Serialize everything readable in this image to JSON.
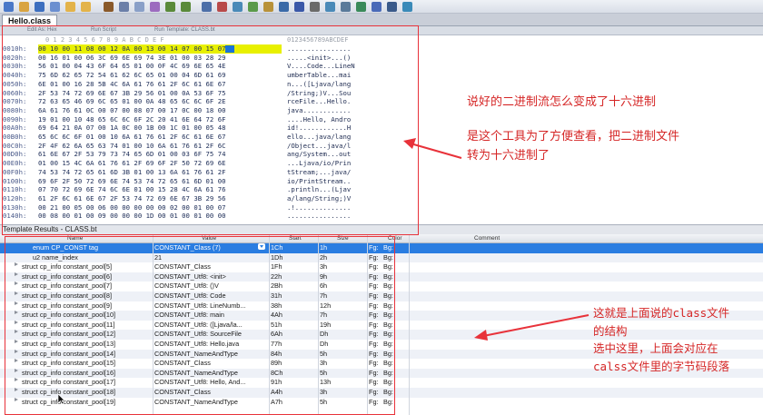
{
  "window": {
    "tab_title": "Hello.class"
  },
  "hex_header": {
    "col_edit_as": "Edit As: Hex",
    "col_run_script": "Run Script",
    "col_run_template": "Run Template: CLASS.bt"
  },
  "offset_ruler": "0 1 2 3 4 5 6 7 8 9 A B C D E F",
  "ascii_ruler": "0123456789ABCDEF",
  "hex_rows": [
    {
      "offset": "0010h:",
      "bytes": "00 10 00 11 08 00 12 0A 00 13 00 14 07 00 15 07",
      "ascii": "................",
      "highlight": true
    },
    {
      "offset": "0020h:",
      "bytes": "00 16 01 00 06 3C 69 6E 69 74 3E 01 00 03 28 29",
      "ascii": ".....<init>...()"
    },
    {
      "offset": "0030h:",
      "bytes": "56 01 00 04 43 6F 64 65 01 00 0F 4C 69 6E 65 4E",
      "ascii": "V....Code...LineN"
    },
    {
      "offset": "0040h:",
      "bytes": "75 6D 62 65 72 54 61 62 6C 65 01 00 04 6D 61 69",
      "ascii": "umberTable...mai"
    },
    {
      "offset": "0050h:",
      "bytes": "6E 01 00 16 28 5B 4C 6A 61 76 61 2F 6C 61 6E 67",
      "ascii": "n...([Ljava/lang"
    },
    {
      "offset": "0060h:",
      "bytes": "2F 53 74 72 69 6E 67 3B 29 56 01 00 0A 53 6F 75",
      "ascii": "/String;)V...Sou"
    },
    {
      "offset": "0070h:",
      "bytes": "72 63 65 46 69 6C 65 01 00 0A 48 65 6C 6C 6F 2E",
      "ascii": "rceFile...Hello."
    },
    {
      "offset": "0080h:",
      "bytes": "6A 61 76 61 0C 00 07 00 08 07 00 17 0C 00 18 00",
      "ascii": "java............"
    },
    {
      "offset": "0090h:",
      "bytes": "19 01 00 10 48 65 6C 6C 6F 2C 20 41 6E 64 72 6F",
      "ascii": "....Hello, Andro"
    },
    {
      "offset": "00A0h:",
      "bytes": "69 64 21 0A 07 00 1A 0C 00 1B 00 1C 01 00 05 48",
      "ascii": "id!............H"
    },
    {
      "offset": "00B0h:",
      "bytes": "65 6C 6C 6F 01 00 10 6A 61 76 61 2F 6C 61 6E 67",
      "ascii": "ello...java/lang"
    },
    {
      "offset": "00C0h:",
      "bytes": "2F 4F 62 6A 65 63 74 01 00 10 6A 61 76 61 2F 6C",
      "ascii": "/Object...java/l"
    },
    {
      "offset": "00D0h:",
      "bytes": "61 6E 67 2F 53 79 73 74 65 6D 01 00 03 6F 75 74",
      "ascii": "ang/System...out"
    },
    {
      "offset": "00E0h:",
      "bytes": "01 00 15 4C 6A 61 76 61 2F 69 6F 2F 50 72 69 6E",
      "ascii": "...Ljava/io/Prin"
    },
    {
      "offset": "00F0h:",
      "bytes": "74 53 74 72 65 61 6D 3B 01 00 13 6A 61 76 61 2F",
      "ascii": "tStream;...java/"
    },
    {
      "offset": "0100h:",
      "bytes": "69 6F 2F 50 72 69 6E 74 53 74 72 65 61 6D 01 00",
      "ascii": "io/PrintStream.."
    },
    {
      "offset": "0110h:",
      "bytes": "07 70 72 69 6E 74 6C 6E 01 00 15 28 4C 6A 61 76",
      "ascii": ".println...(Ljav"
    },
    {
      "offset": "0120h:",
      "bytes": "61 2F 6C 61 6E 67 2F 53 74 72 69 6E 67 3B 29 56",
      "ascii": "a/lang/String;)V"
    },
    {
      "offset": "0130h:",
      "bytes": "00 21 00 05 00 06 00 00 00 00 00 02 00 01 00 07",
      "ascii": ".!.............."
    },
    {
      "offset": "0140h:",
      "bytes": "00 08 00 01 00 09 00 00 00 1D 00 01 00 01 00 00",
      "ascii": "................"
    }
  ],
  "template": {
    "title": "Template Results - CLASS.bt",
    "headers": {
      "name": "Name",
      "value": "Value",
      "start": "Start",
      "size": "Size",
      "color": "Color",
      "comment": "Comment"
    },
    "rows": [
      {
        "name": "enum CP_CONST tag",
        "value": "CONSTANT_Class (7)",
        "start": "1Ch",
        "size": "1h",
        "fg": "Fg:",
        "bg": "Bg:",
        "selected": true,
        "indent": 1,
        "expand": false
      },
      {
        "name": "u2 name_index",
        "value": "21",
        "start": "1Dh",
        "size": "2h",
        "fg": "Fg:",
        "bg": "Bg:",
        "indent": 1,
        "expand": false
      },
      {
        "name": "struct cp_info constant_pool[5]",
        "value": "CONSTANT_Class",
        "start": "1Fh",
        "size": "3h",
        "fg": "Fg:",
        "bg": "Bg:",
        "indent": 0,
        "expand": true
      },
      {
        "name": "struct cp_info constant_pool[6]",
        "value": "CONSTANT_Utf8: <init>",
        "start": "22h",
        "size": "9h",
        "fg": "Fg:",
        "bg": "Bg:",
        "indent": 0,
        "expand": true
      },
      {
        "name": "struct cp_info constant_pool[7]",
        "value": "CONSTANT_Utf8: ()V",
        "start": "2Bh",
        "size": "6h",
        "fg": "Fg:",
        "bg": "Bg:",
        "indent": 0,
        "expand": true
      },
      {
        "name": "struct cp_info constant_pool[8]",
        "value": "CONSTANT_Utf8: Code",
        "start": "31h",
        "size": "7h",
        "fg": "Fg:",
        "bg": "Bg:",
        "indent": 0,
        "expand": true
      },
      {
        "name": "struct cp_info constant_pool[9]",
        "value": "CONSTANT_Utf8: LineNumb...",
        "start": "38h",
        "size": "12h",
        "fg": "Fg:",
        "bg": "Bg:",
        "indent": 0,
        "expand": true
      },
      {
        "name": "struct cp_info constant_pool[10]",
        "value": "CONSTANT_Utf8: main",
        "start": "4Ah",
        "size": "7h",
        "fg": "Fg:",
        "bg": "Bg:",
        "indent": 0,
        "expand": true
      },
      {
        "name": "struct cp_info constant_pool[11]",
        "value": "CONSTANT_Utf8: ([Ljava/la...",
        "start": "51h",
        "size": "19h",
        "fg": "Fg:",
        "bg": "Bg:",
        "indent": 0,
        "expand": true
      },
      {
        "name": "struct cp_info constant_pool[12]",
        "value": "CONSTANT_Utf8: SourceFile",
        "start": "6Ah",
        "size": "Dh",
        "fg": "Fg:",
        "bg": "Bg:",
        "indent": 0,
        "expand": true
      },
      {
        "name": "struct cp_info constant_pool[13]",
        "value": "CONSTANT_Utf8: Hello.java",
        "start": "77h",
        "size": "Dh",
        "fg": "Fg:",
        "bg": "Bg:",
        "indent": 0,
        "expand": true
      },
      {
        "name": "struct cp_info constant_pool[14]",
        "value": "CONSTANT_NameAndType",
        "start": "84h",
        "size": "5h",
        "fg": "Fg:",
        "bg": "Bg:",
        "indent": 0,
        "expand": true
      },
      {
        "name": "struct cp_info constant_pool[15]",
        "value": "CONSTANT_Class",
        "start": "89h",
        "size": "3h",
        "fg": "Fg:",
        "bg": "Bg:",
        "indent": 0,
        "expand": true
      },
      {
        "name": "struct cp_info constant_pool[16]",
        "value": "CONSTANT_NameAndType",
        "start": "8Ch",
        "size": "5h",
        "fg": "Fg:",
        "bg": "Bg:",
        "indent": 0,
        "expand": true
      },
      {
        "name": "struct cp_info constant_pool[17]",
        "value": "CONSTANT_Utf8: Hello, And...",
        "start": "91h",
        "size": "13h",
        "fg": "Fg:",
        "bg": "Bg:",
        "indent": 0,
        "expand": true
      },
      {
        "name": "struct cp_info constant_pool[18]",
        "value": "CONSTANT_Class",
        "start": "A4h",
        "size": "3h",
        "fg": "Fg:",
        "bg": "Bg:",
        "indent": 0,
        "expand": true
      },
      {
        "name": "struct cp_info constant_pool[19]",
        "value": "CONSTANT_NameAndType",
        "start": "A7h",
        "size": "5h",
        "fg": "Fg:",
        "bg": "Bg:",
        "indent": 0,
        "expand": true
      }
    ]
  },
  "annotations": {
    "note1": "说好的二进制流怎么变成了十六进制",
    "note2_line1": "是这个工具为了方便查看，把二进制文件",
    "note2_line2": "转为十六进制了",
    "note3_lines": [
      "这就是上面说的class文件",
      "的结构",
      "选中这里，上面会对应在",
      "calss文件里的字节码段落"
    ]
  },
  "colors": {
    "annotation_red": "#e8323a",
    "selection_blue": "#2a7de1",
    "highlight_yellow": "#e8f000"
  },
  "toolbar_icons": [
    "new-icon",
    "open-icon",
    "save-icon",
    "save-all-icon",
    "folder-icon",
    "folder-icon",
    "cut-icon",
    "copy-icon",
    "paste-icon",
    "paste-special-icon",
    "undo-icon",
    "redo-icon",
    "find-icon",
    "replace-icon",
    "goto-icon",
    "bookmark-icon",
    "script-icon",
    "template-icon",
    "hex-icon",
    "text-icon",
    "compare-icon",
    "calculator-icon",
    "tools-icon",
    "chart-icon",
    "wrench-icon",
    "help-icon"
  ]
}
